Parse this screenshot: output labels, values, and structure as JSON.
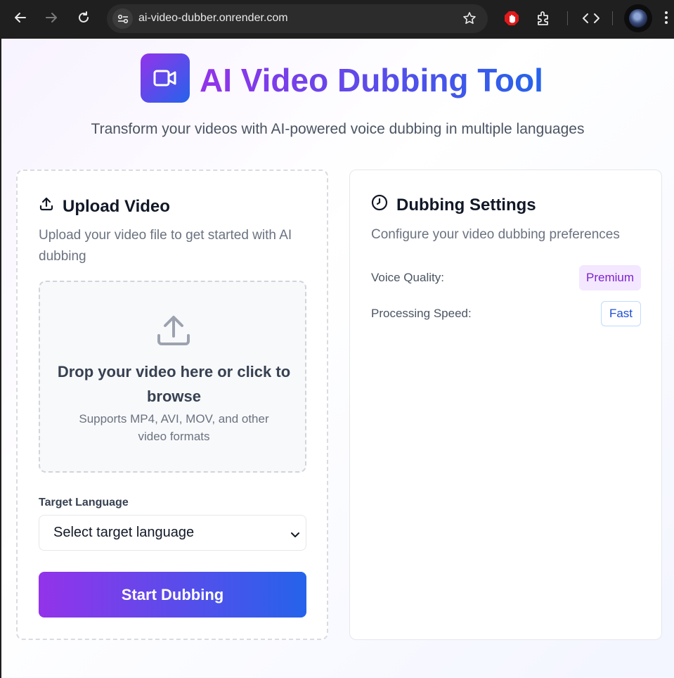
{
  "browser": {
    "url": "ai-video-dubber.onrender.com"
  },
  "header": {
    "title": "AI Video Dubbing Tool",
    "subtitle": "Transform your videos with AI-powered voice dubbing in multiple languages"
  },
  "upload": {
    "heading": "Upload Video",
    "description": "Upload your video file to get started with AI dubbing",
    "dropzone_title": "Drop your video here or click to browse",
    "dropzone_sub": "Supports MP4, AVI, MOV, and other video formats",
    "language_label": "Target Language",
    "language_selected": "Select target language",
    "start_label": "Start Dubbing"
  },
  "settings": {
    "heading": "Dubbing Settings",
    "description": "Configure your video dubbing preferences",
    "rows": [
      {
        "label": "Voice Quality:",
        "value": "Premium"
      },
      {
        "label": "Processing Speed:",
        "value": "Fast"
      }
    ]
  },
  "colors": {
    "gradient_start": "#9333ea",
    "gradient_end": "#2563eb",
    "premium_badge_bg": "#f3e8ff",
    "fast_badge_border": "#bfdbfe"
  },
  "icons": [
    "back-arrow-icon",
    "forward-arrow-icon",
    "reload-icon",
    "site-settings-icon",
    "star-icon",
    "extension-stop-icon",
    "puzzle-icon",
    "code-icon",
    "kebab-menu-icon",
    "video-camera-icon",
    "upload-icon",
    "history-icon",
    "chevron-down-icon"
  ]
}
